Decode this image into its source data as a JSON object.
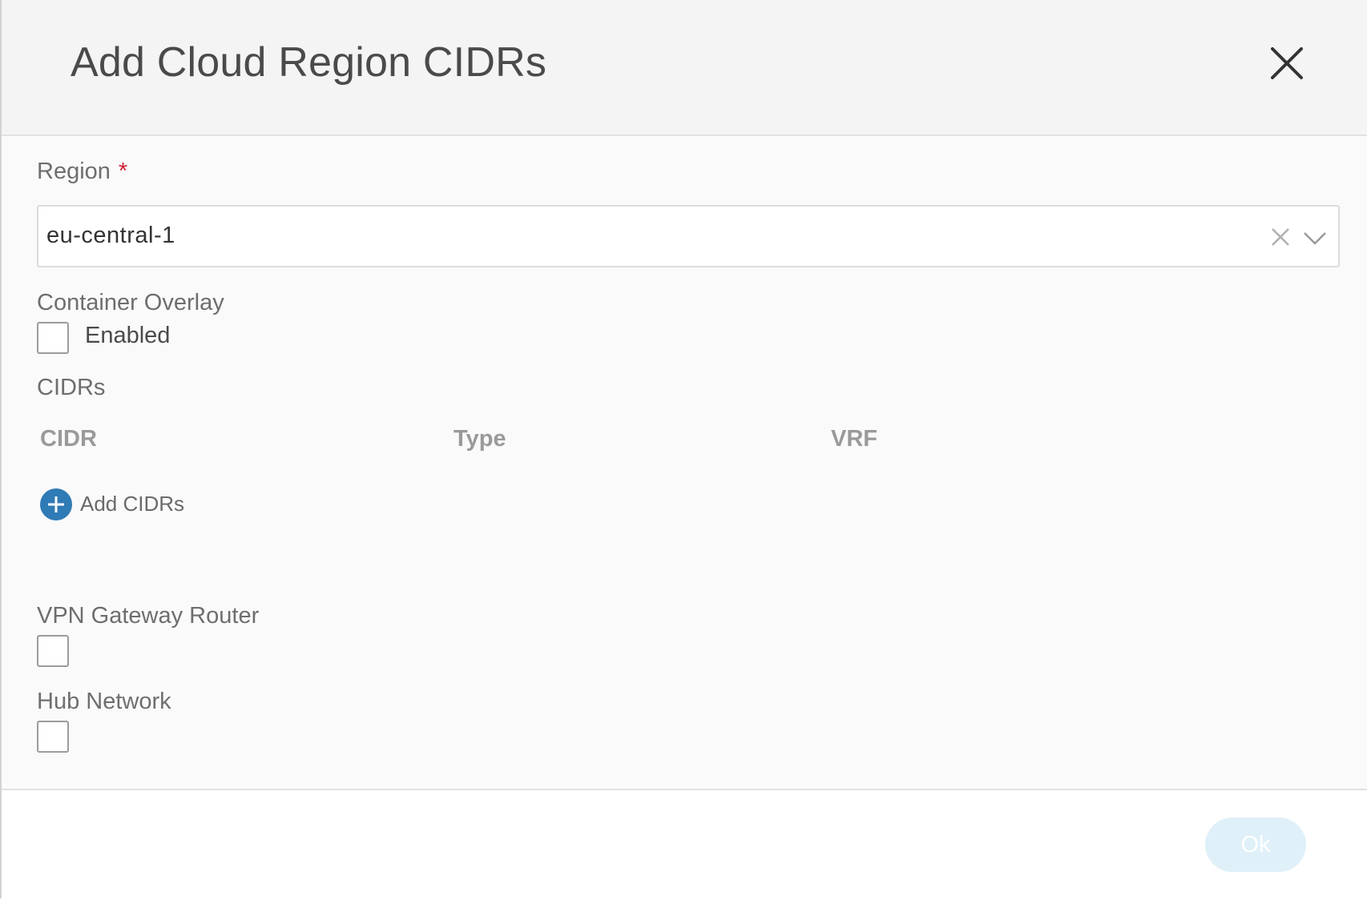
{
  "dialog": {
    "title": "Add Cloud Region CIDRs",
    "close_icon": "close-icon"
  },
  "region": {
    "label": "Region",
    "required_marker": "*",
    "value": "eu-central-1",
    "clear_icon": "clear-icon",
    "dropdown_icon": "chevron-down-icon"
  },
  "container_overlay": {
    "label": "Container Overlay",
    "checkbox_label": "Enabled",
    "checked": false
  },
  "cidrs": {
    "label": "CIDRs",
    "columns": [
      "CIDR",
      "Type",
      "VRF"
    ],
    "rows": [],
    "add_label": "Add CIDRs",
    "add_icon": "plus-circle-icon"
  },
  "vpn_gateway_router": {
    "label": "VPN Gateway Router",
    "checked": false
  },
  "hub_network": {
    "label": "Hub Network",
    "checked": false
  },
  "footer": {
    "ok_label": "Ok",
    "ok_disabled": true
  },
  "colors": {
    "accent": "#2f7bb5",
    "required": "#cf2030",
    "ok_disabled_bg": "#dff0f9"
  }
}
